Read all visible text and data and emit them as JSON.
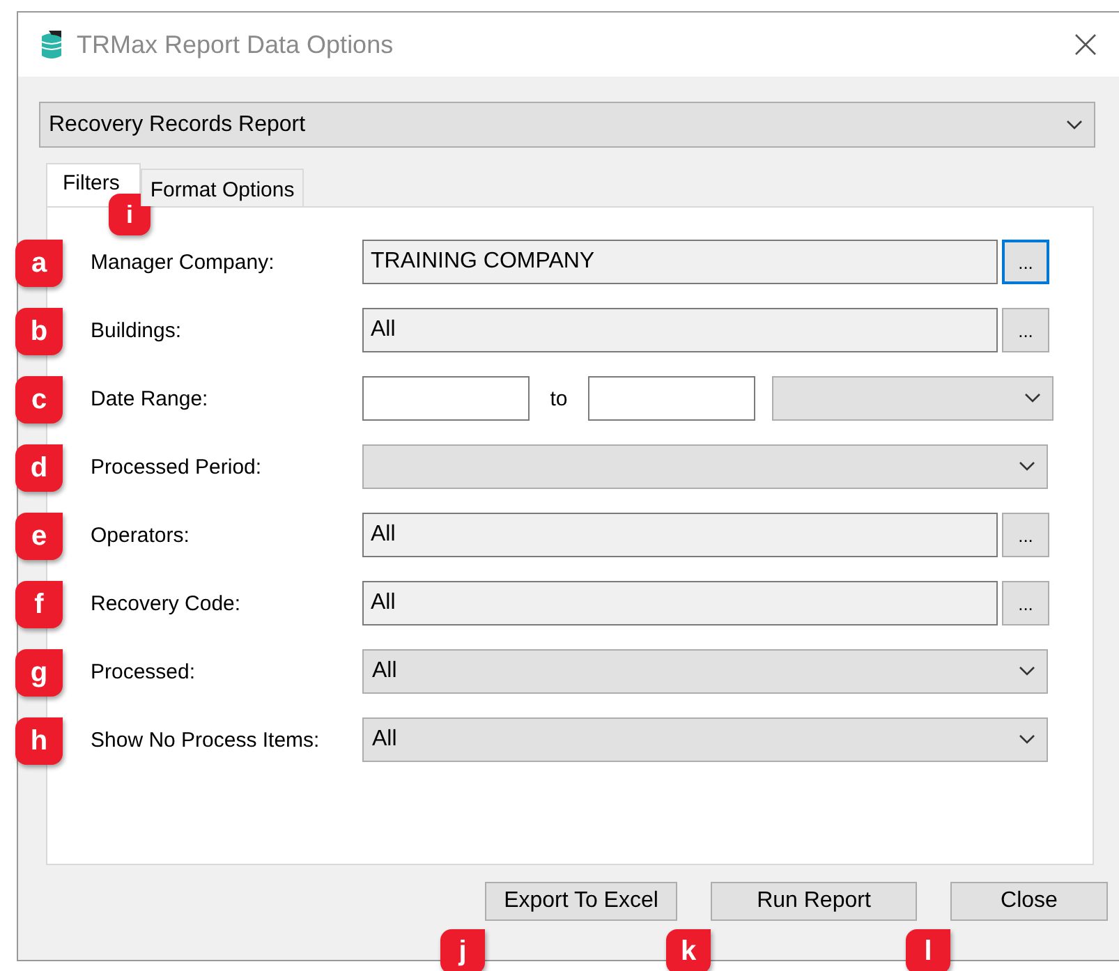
{
  "window": {
    "title": "TRMax Report Data Options"
  },
  "report_select": {
    "value": "Recovery Records Report"
  },
  "tabs": [
    {
      "label": "Filters",
      "selected": true,
      "callout": "i"
    },
    {
      "label": "Format Options",
      "selected": false
    }
  ],
  "rows": [
    {
      "kind": "browse",
      "label": "Manager Company:",
      "value": "TRAINING COMPANY",
      "button": "...",
      "focused": true,
      "callout": "a"
    },
    {
      "kind": "browse",
      "label": "Buildings:",
      "value": "All",
      "button": "...",
      "focused": false,
      "callout": "b"
    },
    {
      "kind": "date_range",
      "label": "Date Range:",
      "separator": "to",
      "callout": "c"
    },
    {
      "kind": "dropdown",
      "label": "Processed Period:",
      "callout": "d"
    },
    {
      "kind": "browse",
      "label": "Operators:",
      "value": "All",
      "button": "...",
      "focused": false,
      "callout": "e"
    },
    {
      "kind": "browse",
      "label": "Recovery Code:",
      "value": "All",
      "button": "...",
      "focused": false,
      "callout": "f"
    },
    {
      "kind": "dropdown",
      "label": "Processed:",
      "value": "All",
      "callout": "g"
    },
    {
      "kind": "dropdown",
      "label": "Show No Process Items:",
      "value": "All",
      "callout": "h"
    }
  ],
  "buttons": [
    {
      "label": "Export To Excel",
      "callout": "j"
    },
    {
      "label": "Run Report",
      "callout": "k"
    },
    {
      "label": "Close",
      "callout": "l"
    }
  ]
}
